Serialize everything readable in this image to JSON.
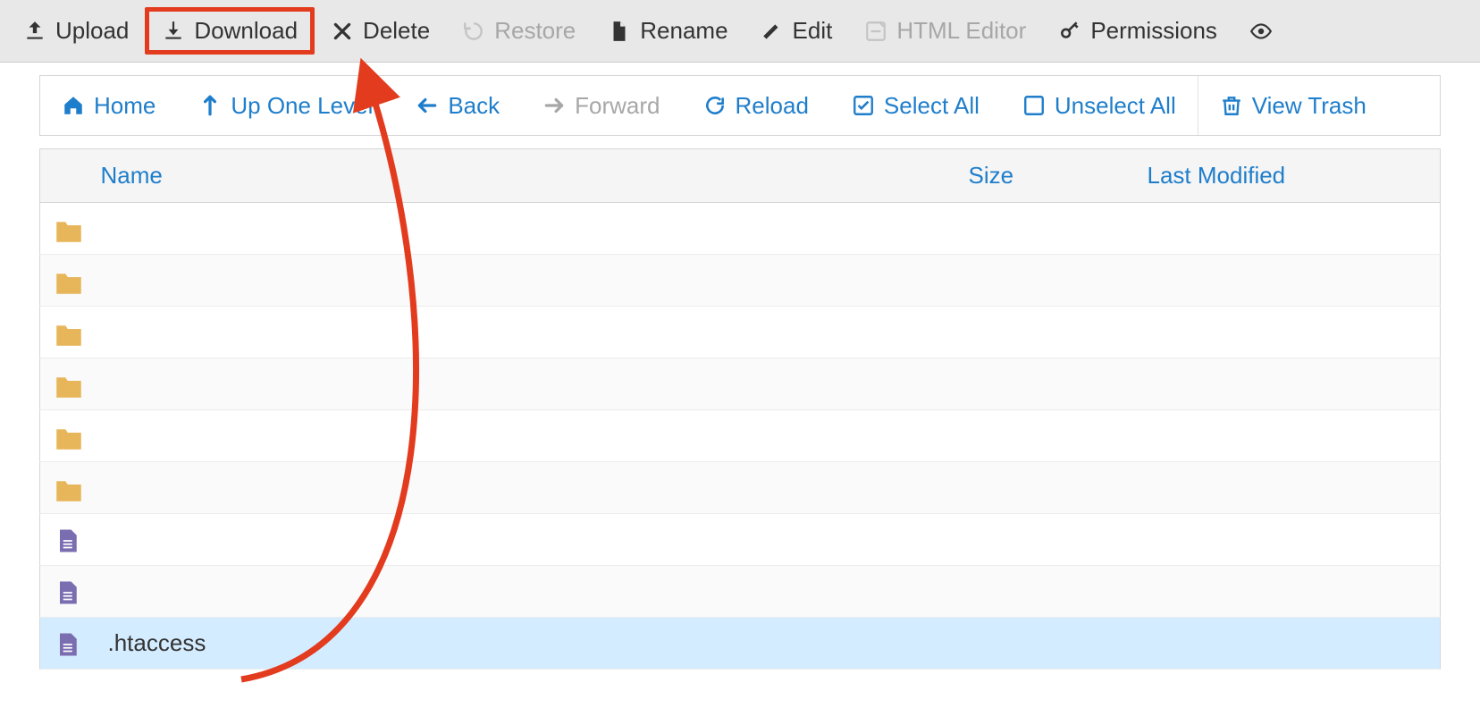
{
  "toolbar": {
    "upload": "Upload",
    "download": "Download",
    "delete": "Delete",
    "restore": "Restore",
    "rename": "Rename",
    "edit": "Edit",
    "html_editor": "HTML Editor",
    "permissions": "Permissions"
  },
  "nav": {
    "home": "Home",
    "up": "Up One Level",
    "back": "Back",
    "forward": "Forward",
    "reload": "Reload",
    "select_all": "Select All",
    "unselect_all": "Unselect All",
    "view_trash": "View Trash"
  },
  "columns": {
    "name": "Name",
    "size": "Size",
    "modified": "Last Modified"
  },
  "rows": [
    {
      "type": "folder",
      "name": "",
      "size": "",
      "modified": "",
      "selected": false
    },
    {
      "type": "folder",
      "name": "",
      "size": "",
      "modified": "",
      "selected": false
    },
    {
      "type": "folder",
      "name": "",
      "size": "",
      "modified": "",
      "selected": false
    },
    {
      "type": "folder",
      "name": "",
      "size": "",
      "modified": "",
      "selected": false
    },
    {
      "type": "folder",
      "name": "",
      "size": "",
      "modified": "",
      "selected": false
    },
    {
      "type": "folder",
      "name": "",
      "size": "",
      "modified": "",
      "selected": false
    },
    {
      "type": "file",
      "name": "",
      "size": "",
      "modified": "",
      "selected": false
    },
    {
      "type": "file",
      "name": "",
      "size": "",
      "modified": "",
      "selected": false
    },
    {
      "type": "file",
      "name": ".htaccess",
      "size": "",
      "modified": "",
      "selected": true
    }
  ],
  "annotation": {
    "highlight_target": "download-button",
    "arrow_from_row_index": 8
  }
}
